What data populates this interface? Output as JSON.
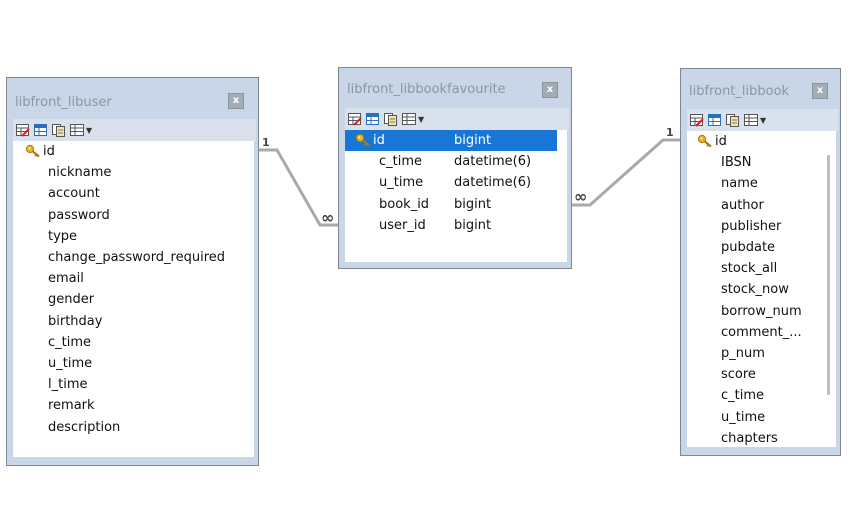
{
  "tables": [
    {
      "title": "libfront_libuser",
      "close": "x",
      "fields": [
        {
          "name": "id",
          "key": true
        },
        {
          "name": "nickname"
        },
        {
          "name": "account"
        },
        {
          "name": "password"
        },
        {
          "name": "type"
        },
        {
          "name": "change_password_required"
        },
        {
          "name": "email"
        },
        {
          "name": "gender"
        },
        {
          "name": "birthday"
        },
        {
          "name": "c_time"
        },
        {
          "name": "u_time"
        },
        {
          "name": "l_time"
        },
        {
          "name": "remark"
        },
        {
          "name": "description"
        }
      ]
    },
    {
      "title": "libfront_libbookfavourite",
      "close": "x",
      "fields": [
        {
          "name": "id",
          "type": "bigint",
          "key": true,
          "selected": true
        },
        {
          "name": "c_time",
          "type": "datetime(6)"
        },
        {
          "name": "u_time",
          "type": "datetime(6)"
        },
        {
          "name": "book_id",
          "type": "bigint"
        },
        {
          "name": "user_id",
          "type": "bigint"
        }
      ]
    },
    {
      "title": "libfront_libbook",
      "close": "x",
      "fields": [
        {
          "name": "id",
          "key": true
        },
        {
          "name": "IBSN"
        },
        {
          "name": "name"
        },
        {
          "name": "author"
        },
        {
          "name": "publisher"
        },
        {
          "name": "pubdate"
        },
        {
          "name": "stock_all"
        },
        {
          "name": "stock_now"
        },
        {
          "name": "borrow_num"
        },
        {
          "name": "comment_..."
        },
        {
          "name": "p_num"
        },
        {
          "name": "score"
        },
        {
          "name": "c_time"
        },
        {
          "name": "u_time"
        },
        {
          "name": "chapters"
        }
      ]
    }
  ],
  "relations": [
    {
      "one": "1",
      "many": "∞"
    },
    {
      "one": "1",
      "many": "∞"
    }
  ],
  "icons": {
    "toolbar": [
      "design-table-icon",
      "table-data-icon",
      "copy-icon",
      "grid-view-icon",
      "dropdown-icon"
    ],
    "key": "key-icon"
  },
  "colors": {
    "panel": "#c9d6e7",
    "selection": "#1877d6",
    "title_text": "#8c96a2"
  }
}
